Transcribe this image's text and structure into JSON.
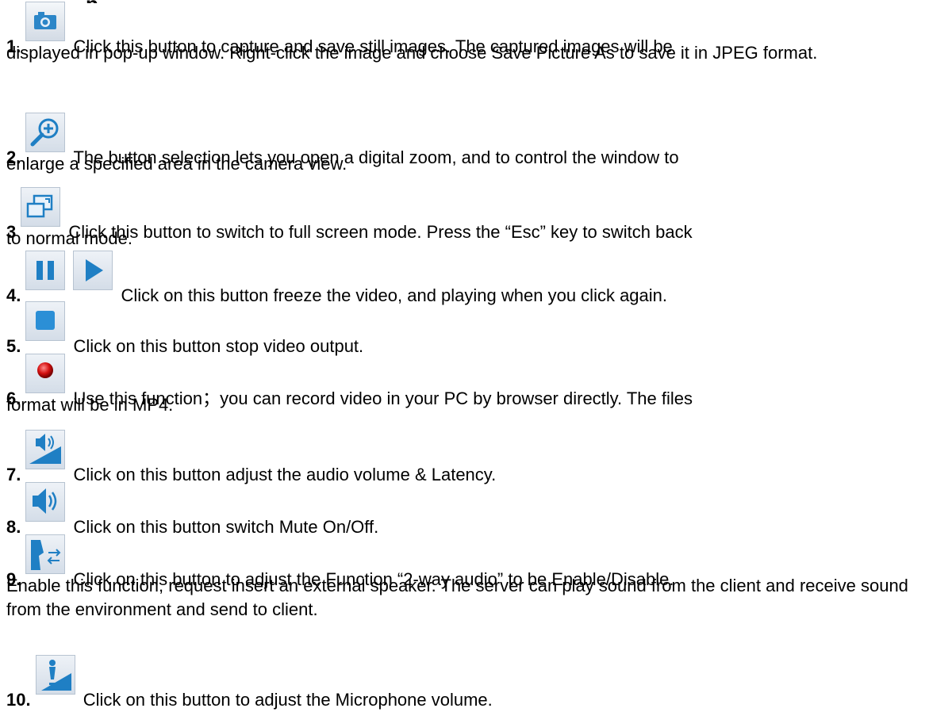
{
  "heading_partial": "p",
  "items": [
    {
      "number": "1.",
      "icon": "camera-icon",
      "text_line1": "Click this button to capture and save still images. The captured images will be",
      "text_rest": "displayed in pop-up window. Right-click the image and choose Save Picture As to save it in JPEG format."
    },
    {
      "number": "2.",
      "icon": "zoom-in-icon",
      "text_line1": "The button selection lets you open a digital zoom, and to control the window to",
      "text_rest": "enlarge a specified area in the camera view."
    },
    {
      "number": "3",
      "icon": "fullscreen-icon",
      "text_line1": "Click this button to switch to full screen mode. Press the “Esc” key to switch back",
      "text_rest": "to normal mode."
    },
    {
      "number": "4.",
      "icon": "pause-icon",
      "icon2": "play-icon",
      "text_line1": "Click on this button freeze the video, and playing when you click again.",
      "text_rest": ""
    },
    {
      "number": "5.",
      "icon": "stop-icon",
      "text_line1": "Click on this button stop video output.",
      "text_rest": ""
    },
    {
      "number": "6.",
      "icon": "record-icon",
      "text_line1": "Use this function；you can record video in your PC by browser directly. The files",
      "text_rest": "format will be in MP4."
    },
    {
      "number": "7.",
      "icon": "volume-adjust-icon",
      "text_line1": "Click on this button adjust the audio volume & Latency.",
      "text_rest": ""
    },
    {
      "number": "8.",
      "icon": "speaker-icon",
      "text_line1": "Click on this button switch Mute On/Off.",
      "text_rest": ""
    },
    {
      "number": "9.",
      "icon": "two-way-audio-icon",
      "text_line1": "Click on this button to adjust the Function “2-way audio” to be Enable/Disable.",
      "text_rest": "Enable this function, request insert an external speaker. The server can play sound from the client and receive sound from the environment and send to client."
    },
    {
      "number": "10.",
      "icon": "microphone-volume-icon",
      "text_line1": "Click on this button to adjust the Microphone volume.",
      "text_rest": ""
    }
  ]
}
